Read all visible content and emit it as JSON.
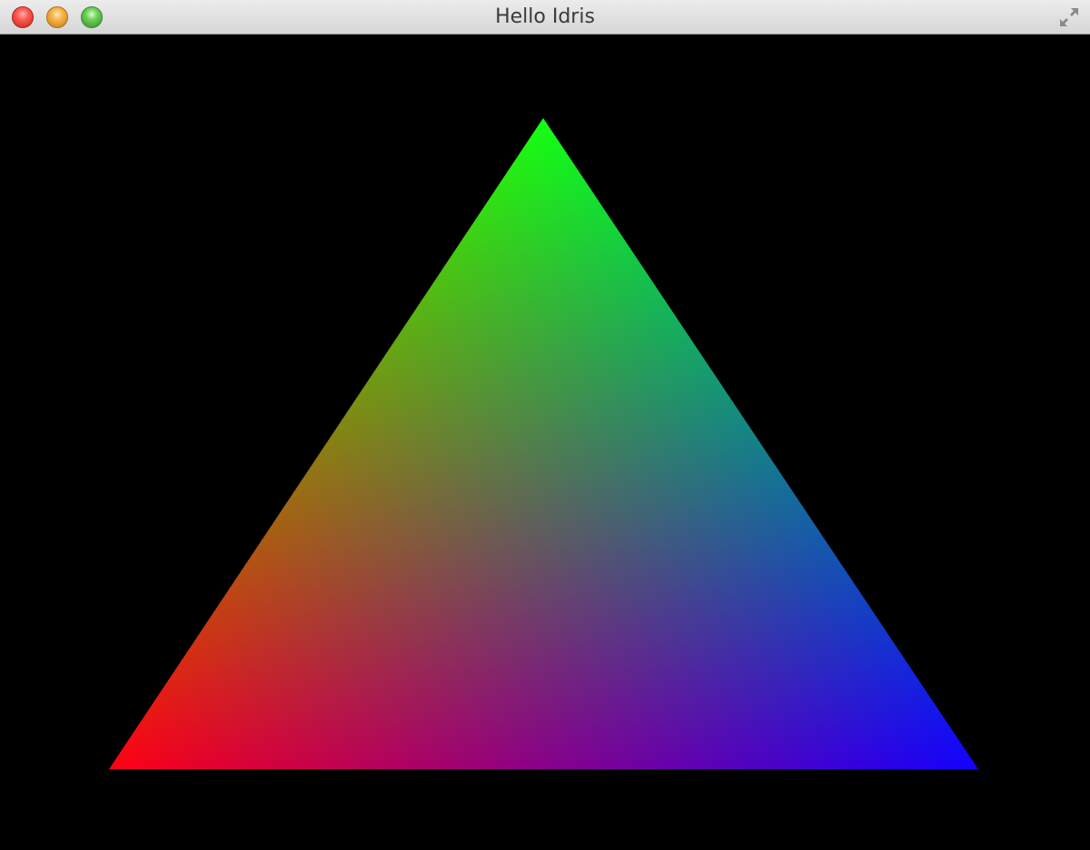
{
  "window": {
    "title": "Hello Idris",
    "buttons": {
      "close": "close-button",
      "minimize": "minimize-button",
      "zoom": "zoom-button",
      "fullscreen": "fullscreen-button"
    }
  },
  "scene": {
    "background_color": "#000000",
    "shape": "triangle",
    "vertex_colors": {
      "top": "#00ff00",
      "bottom_left": "#ff0000",
      "bottom_right": "#0000ff"
    }
  }
}
